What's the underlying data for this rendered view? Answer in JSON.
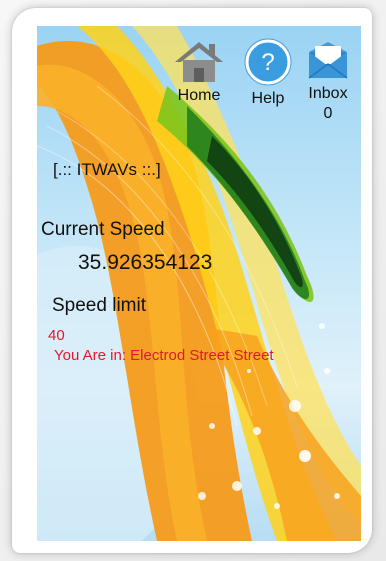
{
  "nav": {
    "home_label": "Home",
    "help_label": "Help",
    "inbox_label": "Inbox",
    "inbox_count": "0"
  },
  "app_title": "[.:: ITWAVs ::.]",
  "speed": {
    "current_label": "Current Speed",
    "current_value": "35.926354123",
    "limit_label": "Speed limit",
    "limit_value": "40",
    "location_text": "You Are in: Electrod Street Street"
  },
  "colors": {
    "alert_red": "#e0192b"
  }
}
